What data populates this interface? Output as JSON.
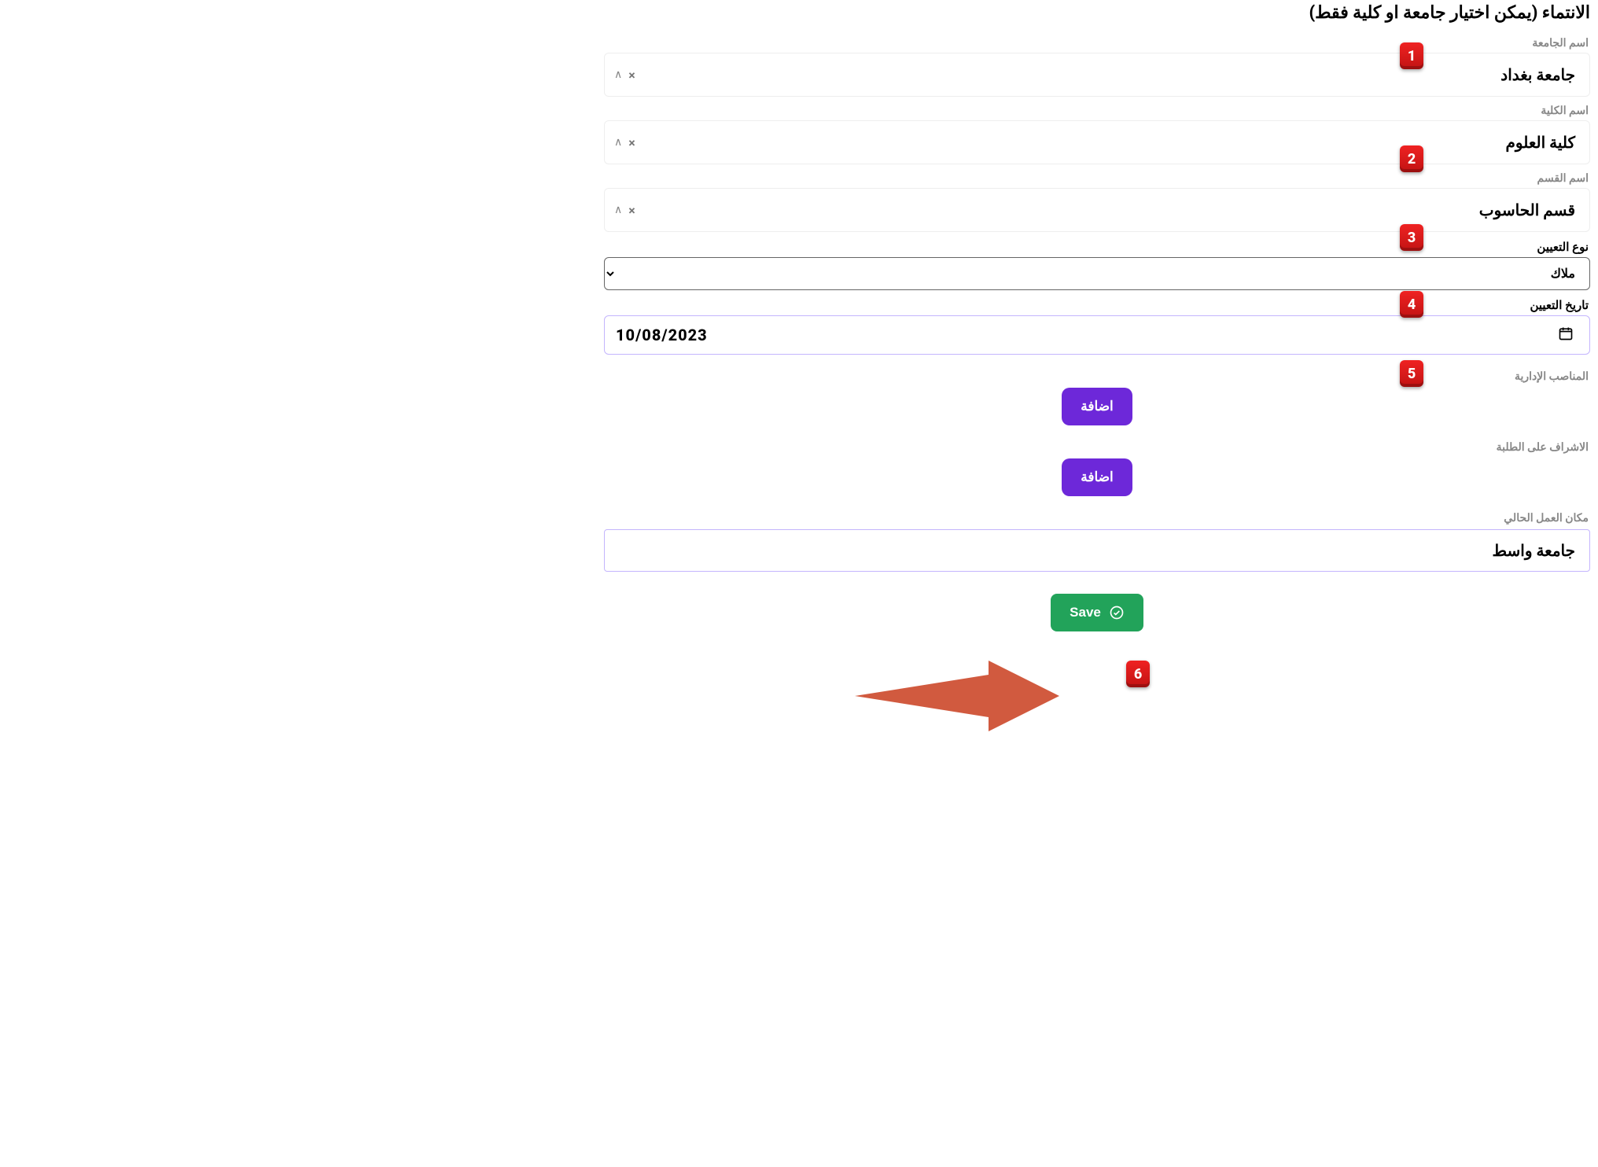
{
  "section_title": "الانتماء (يمكن اختيار جامعة او كلية فقط)",
  "university": {
    "label": "اسم الجامعة",
    "value": "جامعة بغداد"
  },
  "college": {
    "label": "اسم الكلية",
    "value": "كلية العلوم"
  },
  "department": {
    "label": "اسم القسم",
    "value": "قسم الحاسوب"
  },
  "appointment_type": {
    "label": "نوع التعيين",
    "value": "ملاك"
  },
  "appointment_date": {
    "label": "تاريخ التعيين",
    "value": "10/08/2023"
  },
  "admin_positions": {
    "label": "المناصب الإدارية",
    "add_label": "اضافة"
  },
  "supervision": {
    "label": "الاشراف على الطلبة",
    "add_label": "اضافة"
  },
  "current_workplace": {
    "label": "مكان العمل الحالي",
    "value": "جامعة واسط"
  },
  "save_label": "Save",
  "badges": {
    "b1": "1",
    "b2": "2",
    "b3": "3",
    "b4": "4",
    "b5": "5",
    "b6": "6"
  }
}
